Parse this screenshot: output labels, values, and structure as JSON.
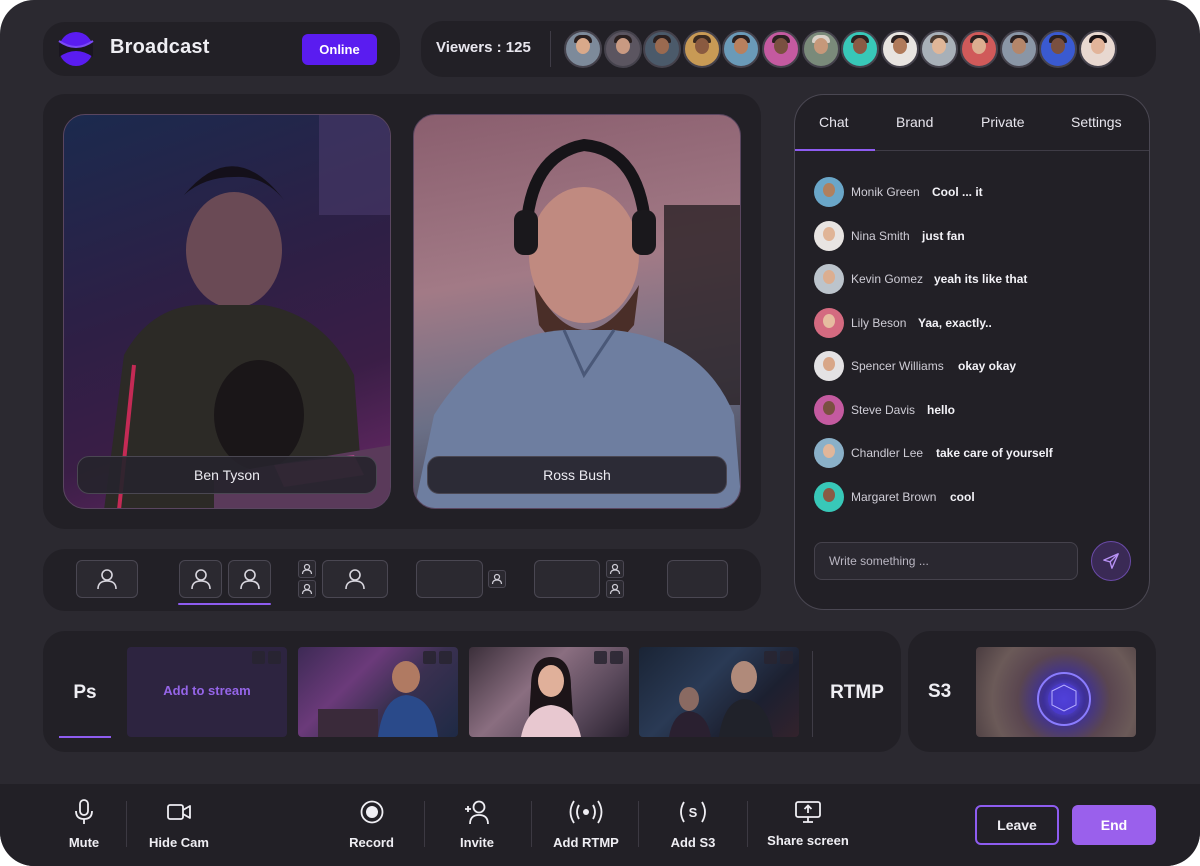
{
  "header": {
    "app_title": "Broadcast",
    "status_badge": "Online",
    "viewers_label": "Viewers : 125",
    "viewer_avatar_count": 14,
    "colors": {
      "accent": "#5a1cf0",
      "purple": "#8e5cf0",
      "background": "#2b2930"
    }
  },
  "stage": {
    "participants": [
      {
        "name": "Ben Tyson"
      },
      {
        "name": "Ross Bush"
      }
    ]
  },
  "chat": {
    "tabs": [
      {
        "label": "Chat",
        "active": true
      },
      {
        "label": "Brand",
        "active": false
      },
      {
        "label": "Private",
        "active": false
      },
      {
        "label": "Settings",
        "active": false
      }
    ],
    "messages": [
      {
        "user": "Monik Green",
        "text": "Cool ... it"
      },
      {
        "user": "Nina Smith",
        "text": "just fan"
      },
      {
        "user": "Kevin Gomez",
        "text": "yeah its like that"
      },
      {
        "user": "Lily Beson",
        "text": "Yaa, exactly.."
      },
      {
        "user": "Spencer Williams",
        "text": "okay okay"
      },
      {
        "user": "Steve Davis",
        "text": "hello"
      },
      {
        "user": "Chandler Lee",
        "text": "take care of yourself"
      },
      {
        "user": "Margaret Brown",
        "text": "cool"
      }
    ],
    "input_placeholder": "Write something ...",
    "send_icon": "send-icon"
  },
  "sources": {
    "ps_label": "Ps",
    "add_to_stream": "Add to stream",
    "rtmp_label": "RTMP",
    "s3_label": "S3"
  },
  "controls": {
    "mute": "Mute",
    "hide_cam": "Hide Cam",
    "record": "Record",
    "invite": "Invite",
    "add_rtmp": "Add RTMP",
    "add_s3": "Add S3",
    "share_screen": "Share screen",
    "leave": "Leave",
    "end": "End"
  }
}
